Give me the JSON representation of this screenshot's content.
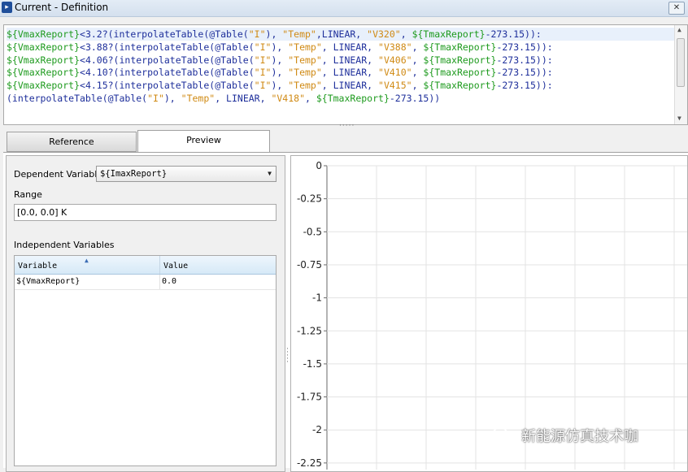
{
  "window": {
    "title": "Current - Definition",
    "close_glyph": "✕"
  },
  "code": {
    "lines": [
      [
        "${VmaxReport}",
        "<3.2?(interpolateTable(",
        "@Table(",
        "\"I\"",
        "), ",
        "\"Temp\"",
        ",LINEAR, ",
        "\"V320\"",
        ", ",
        "${TmaxReport}",
        "-273.15)):"
      ],
      [
        "${VmaxReport}",
        "<3.88?(interpolateTable(",
        "@Table(",
        "\"I\"",
        "), ",
        "\"Temp\"",
        ", LINEAR, ",
        "\"V388\"",
        ", ",
        "${TmaxReport}",
        "-273.15)):"
      ],
      [
        "${VmaxReport}",
        "<4.06?(interpolateTable(",
        "@Table(",
        "\"I\"",
        "), ",
        "\"Temp\"",
        ", LINEAR, ",
        "\"V406\"",
        ", ",
        "${TmaxReport}",
        "-273.15)):"
      ],
      [
        "${VmaxReport}",
        "<4.10?(interpolateTable(",
        "@Table(",
        "\"I\"",
        "), ",
        "\"Temp\"",
        ", LINEAR, ",
        "\"V410\"",
        ", ",
        "${TmaxReport}",
        "-273.15)):"
      ],
      [
        "${VmaxReport}",
        "<4.15?(interpolateTable(",
        "@Table(",
        "\"I\"",
        "), ",
        "\"Temp\"",
        ", LINEAR, ",
        "\"V415\"",
        ", ",
        "${TmaxReport}",
        "-273.15)):"
      ],
      [
        "",
        "(interpolateTable(",
        "@Table(",
        "\"I\"",
        "), ",
        "\"Temp\"",
        ", LINEAR, ",
        "\"V418\"",
        ", ",
        "${TmaxReport}",
        "-273.15))"
      ]
    ],
    "colors": {
      "variable": "#1d9a1d",
      "string": "#d08a14",
      "keyword": "#1e2f9b"
    }
  },
  "tabs": {
    "reference": "Reference",
    "preview": "Preview",
    "active": "Preview"
  },
  "left": {
    "dependent_label": "Dependent Variable",
    "dependent_value": "${ImaxReport}",
    "range_label": "Range",
    "range_value": "[0.0, 0.0] K",
    "independent_label": "Independent Variables",
    "columns": [
      "Variable",
      "Value"
    ],
    "rows": [
      {
        "variable": "${VmaxReport}",
        "value": "0.0"
      }
    ]
  },
  "chart_data": {
    "type": "line",
    "title": "",
    "xlabel": "",
    "ylabel": "",
    "ylim": [
      -2.3,
      0
    ],
    "y_ticks": [
      0,
      -0.25,
      -0.5,
      -0.75,
      -1,
      -1.25,
      -1.5,
      -1.75,
      -2,
      -2.25
    ],
    "y_tick_labels": [
      "0",
      "-0.25",
      "-0.5",
      "-0.75",
      "-1",
      "-1.25",
      "-1.5",
      "-1.75",
      "-2",
      "-2.25"
    ],
    "grid": true,
    "series": []
  },
  "watermark": {
    "text": "新能源仿真技术咖",
    "icon": "wechat-icon"
  }
}
